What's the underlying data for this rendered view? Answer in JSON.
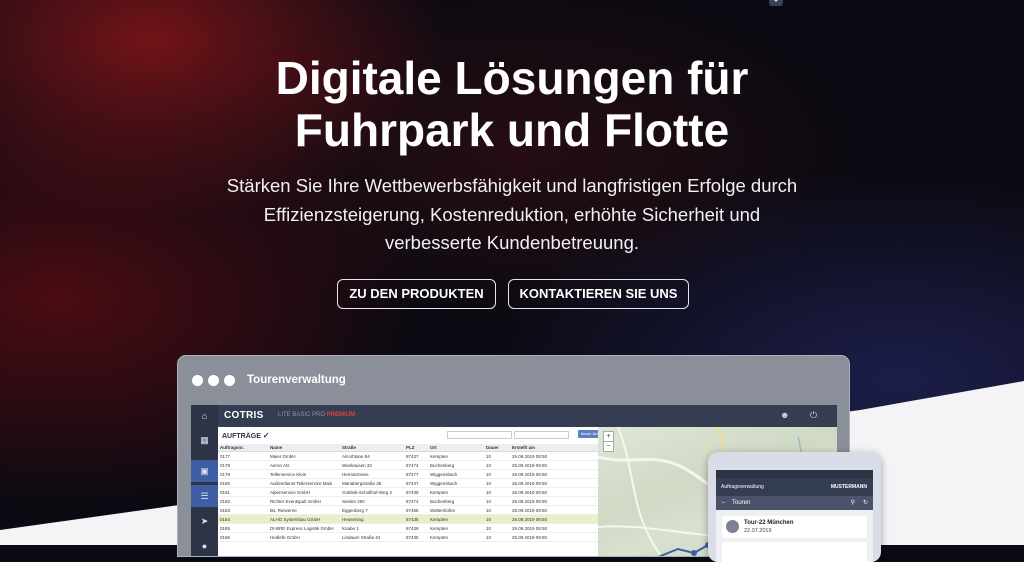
{
  "hero": {
    "title_line1": "Digitale Lösungen für",
    "title_line2": "Fuhrpark und Flotte",
    "subtitle_line1": "Stärken Sie Ihre Wettbewerbsfähigkeit und langfristigen Erfolge durch",
    "subtitle_line2": "Effizienzsteigerung, Kostenreduktion, erhöhte Sicherheit und",
    "subtitle_line3": "verbesserte Kundenbetreuung.",
    "button_products": "ZU DEN PRODUKTEN",
    "button_contact": "KONTAKTIEREN SIE UNS"
  },
  "window": {
    "title": "Tourenverwaltung"
  },
  "app": {
    "logo": "COTRIS",
    "plans": [
      "LITE",
      "BASIC",
      "PRO"
    ],
    "plan_premium": "PREMIUM",
    "panel_title": "AUFTRÄGE",
    "new_order_button": "Neuer Auftrag",
    "columns": [
      "Auftragsnr.",
      "Name",
      "Straße",
      "PLZ",
      "Ort",
      "Dauer",
      "Erstellt am"
    ],
    "rows": [
      [
        "0177",
        "Maier GmbH",
        "Alcorhtane 84",
        "87437",
        "Kempten",
        "10",
        "26.09.2019 09:50"
      ],
      [
        "0178",
        "Aeron AG",
        "Wankausen 33",
        "87474",
        "Buchenberg",
        "10",
        "26.09.2019 09:50"
      ],
      [
        "0179",
        "Tellerservice Klein",
        "Hermanniess",
        "87477",
        "Wiggensbach",
        "10",
        "26.09.2019 09:50"
      ],
      [
        "0180",
        "Außendienst Tellerservice Mais",
        "Mariabergstraße 36",
        "87437",
        "Wiggensbach",
        "10",
        "26.09.2019 09:50"
      ],
      [
        "0181",
        "Alpenservice GmbH",
        "Gottlieb-Schollhof-Weg 2",
        "87439",
        "Kempten",
        "10",
        "26.09.2019 09:50"
      ],
      [
        "0182",
        "Richter Eventspult GmbH",
        "Seelen 250",
        "87474",
        "Buchenberg",
        "10",
        "26.09.2019 09:50"
      ],
      [
        "0183",
        "Bs. Riewerne",
        "Eggenberg 7",
        "87466",
        "Waltenhofen",
        "10",
        "26.09.2019 09:50"
      ],
      [
        "0184",
        "ALHO Systembau GmbH",
        "Heusening",
        "87435",
        "Kempten",
        "10",
        "26.09.2019 09:50"
      ],
      [
        "0185",
        "DI-BRE Express Logistik GmbH",
        "Knabe 1",
        "87439",
        "Kempten",
        "10",
        "26.09.2019 09:50"
      ],
      [
        "0186",
        "Hedlefe GmbH",
        "Lindauer Straße 61",
        "87435",
        "Kempten",
        "10",
        "26.09.2019 09:50"
      ]
    ],
    "highlighted_row_index": 7
  },
  "tablet": {
    "app_title": "Auftragsverwaltung",
    "user": "MUSTERMANN",
    "section": "Touren",
    "tour_name": "Tour-22 München",
    "tour_date": "22.07.2019"
  },
  "colors": {
    "accent_blue": "#3f5ea4",
    "premium_red": "#e0413b",
    "highlight_row": "#e7f0c9"
  },
  "icons": [
    "home-icon",
    "dashboard-icon",
    "orders-icon",
    "list-icon",
    "send-icon",
    "users-icon",
    "power-icon",
    "check-circle-icon",
    "back-arrow-icon",
    "search-icon",
    "refresh-icon"
  ]
}
